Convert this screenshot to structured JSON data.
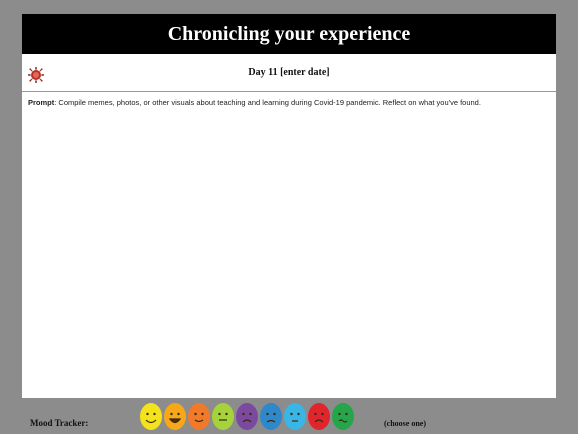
{
  "header": {
    "title": "Chronicling your experience"
  },
  "day": {
    "label": "Day 11 [enter date]"
  },
  "prompt": {
    "label": "Prompt",
    "text": ": Compile memes, photos, or other visuals about teaching and learning during Covid-19 pandemic. Reflect on what you've found."
  },
  "footer": {
    "mood_label": "Mood Tracker:",
    "choose_hint": "(choose one)"
  },
  "moods": [
    {
      "icon": "happy-face-icon",
      "color": "#f4e21c"
    },
    {
      "icon": "grinning-face-icon",
      "color": "#f6a81a"
    },
    {
      "icon": "content-face-icon",
      "color": "#f07a2a"
    },
    {
      "icon": "calm-face-icon",
      "color": "#a6d23c"
    },
    {
      "icon": "worried-face-icon",
      "color": "#7b4a9e"
    },
    {
      "icon": "sad-face-icon",
      "color": "#2e88c9"
    },
    {
      "icon": "neutral-face-icon",
      "color": "#39b6e6"
    },
    {
      "icon": "angry-face-icon",
      "color": "#e1252c"
    },
    {
      "icon": "sick-face-icon",
      "color": "#27a54a"
    }
  ]
}
